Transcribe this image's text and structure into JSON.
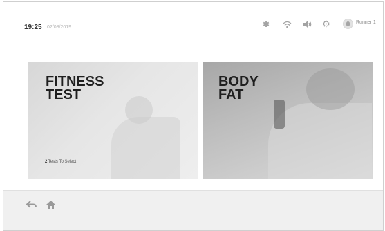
{
  "status": {
    "time": "19:25",
    "date": "02/08/2019",
    "user_name": "Runner 1"
  },
  "icons": {
    "bluetooth": "bluetooth-icon",
    "wifi": "wifi-icon",
    "volume": "volume-icon",
    "settings": "gear-icon",
    "avatar": "user-avatar-icon",
    "back": "back-arrow-icon",
    "home": "home-icon"
  },
  "cards": [
    {
      "title_line1": "FITNESS",
      "title_line2": "TEST",
      "count": "2",
      "sub_text": "Tests To Select"
    },
    {
      "title_line1": "BODY",
      "title_line2": "FAT"
    }
  ]
}
